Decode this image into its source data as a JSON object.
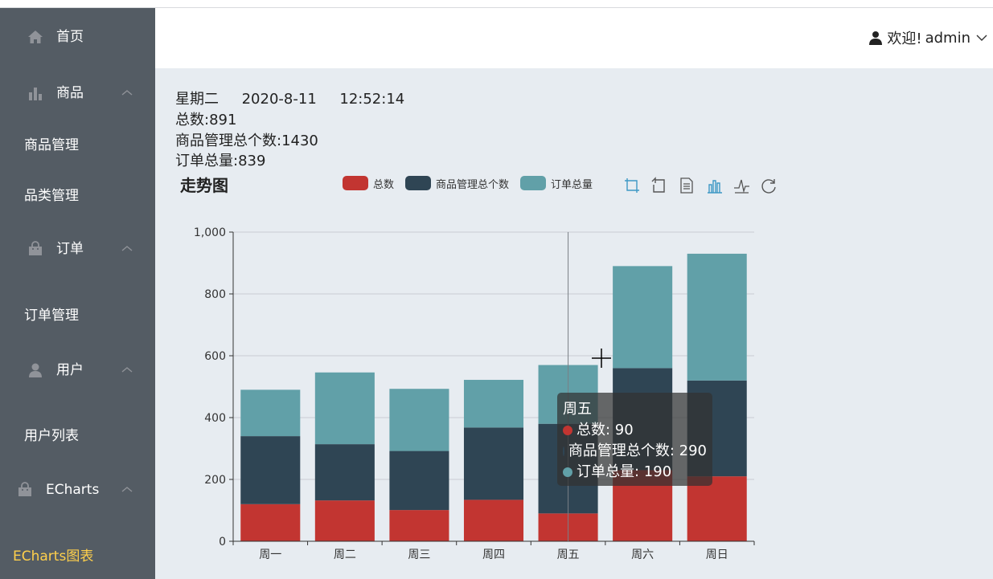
{
  "sidebar": {
    "items": [
      {
        "label": "首页",
        "icon": "home-icon"
      },
      {
        "label": "商品",
        "icon": "bar-chart-icon"
      },
      {
        "label": "商品管理"
      },
      {
        "label": "品类管理"
      },
      {
        "label": "订单",
        "icon": "bag-icon"
      },
      {
        "label": "订单管理"
      },
      {
        "label": "用户",
        "icon": "user-icon"
      },
      {
        "label": "用户列表"
      },
      {
        "label": "ECharts",
        "icon": "bag-icon"
      },
      {
        "label": "ECharts图表"
      }
    ],
    "bg_color": "#545c64",
    "active_color": "#ffd04b"
  },
  "header": {
    "welcome": "欢迎!",
    "username": "admin"
  },
  "info": {
    "weekday": "星期二",
    "date": "2020-8-11",
    "time": "12:52:14",
    "total_label": "总数:",
    "total_value": "891",
    "goods_label": "商品管理总个数:",
    "goods_value": "1430",
    "orders_label": "订单总量:",
    "orders_value": "839"
  },
  "chart_data": {
    "type": "bar",
    "stacked": true,
    "title": "走势图",
    "categories": [
      "周一",
      "周二",
      "周三",
      "周四",
      "周五",
      "周六",
      "周日"
    ],
    "series": [
      {
        "name": "总数",
        "color": "#c23531",
        "values": [
          120,
          132,
          101,
          134,
          90,
          230,
          210
        ]
      },
      {
        "name": "商品管理总个数",
        "color": "#2f4554",
        "values": [
          220,
          182,
          191,
          234,
          290,
          330,
          310
        ]
      },
      {
        "name": "订单总量",
        "color": "#61a0a8",
        "values": [
          150,
          232,
          201,
          154,
          190,
          330,
          410
        ]
      }
    ],
    "ylim": [
      0,
      1000
    ],
    "yticks": [
      0,
      200,
      400,
      600,
      800,
      1000
    ],
    "ytick_labels": [
      "0",
      "200",
      "400",
      "600",
      "800",
      "1,000"
    ],
    "grid": true,
    "legend_position": "top-center",
    "tooltip": {
      "title": "周五",
      "rows": [
        {
          "text": "总数: 90",
          "color": "#c23531"
        },
        {
          "text": "商品管理总个数: 290",
          "color": "#2f4554"
        },
        {
          "text": "订单总量: 190",
          "color": "#61a0a8"
        }
      ]
    }
  },
  "toolbox": [
    "zoom-icon",
    "zoom-reset-icon",
    "data-view-icon",
    "bar-type-icon",
    "line-type-icon",
    "restore-icon"
  ]
}
